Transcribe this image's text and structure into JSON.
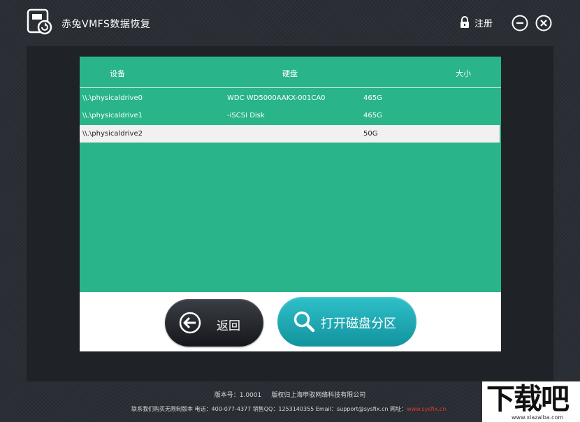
{
  "app": {
    "title": "赤兔VMFS数据恢复",
    "register_label": "注册"
  },
  "table": {
    "headers": [
      "设备",
      "硬盘",
      "大小"
    ],
    "rows": [
      {
        "device": "\\\\.\\physicaldrive0",
        "disk": "WDC WD5000AAKX-001CA0",
        "size": "465G",
        "selected": false
      },
      {
        "device": "\\\\.\\physicaldrive1",
        "disk": "-iSCSI Disk",
        "size": "465G",
        "selected": false
      },
      {
        "device": "\\\\.\\physicaldrive2",
        "disk": "",
        "size": "50G",
        "selected": true
      }
    ]
  },
  "buttons": {
    "back": "返回",
    "open": "打开磁盘分区"
  },
  "footer": {
    "version": "版本号：1.0001",
    "copyright": "版权归上海甲驭网络科技有限公司",
    "contact": "联系我们购买无限制版本  电话：400-077-4377 销售QQ：1253140355 Email：support@sysfix.cn 网址：",
    "website": "www.sysfix.cn"
  },
  "watermark": {
    "big": "下载吧",
    "small": "www.xiazaiba.com"
  },
  "colors": {
    "table_bg": "#29b48a",
    "selected_row": "#f1f1f1",
    "open_button": "#1aa8b2",
    "back_button": "#25282e",
    "link_red": "#e03a2e"
  },
  "icons": {
    "logo": "hard-disk-restore-icon",
    "lock": "lock-icon",
    "minimize": "minimize-icon",
    "close": "close-icon",
    "back": "arrow-left-icon",
    "open": "search-icon"
  }
}
